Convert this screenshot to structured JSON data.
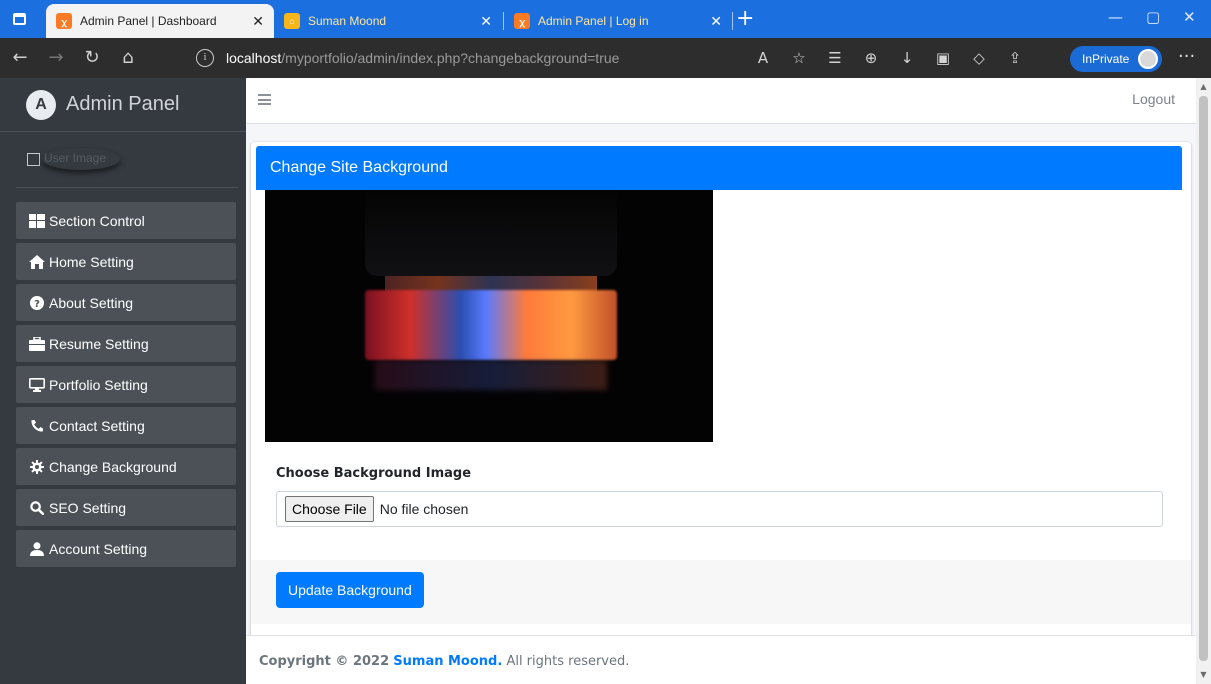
{
  "browser": {
    "tabs": [
      {
        "title": "Admin Panel | Dashboard",
        "favicon": "xampp-icon",
        "active": true
      },
      {
        "title": "Suman Moond",
        "favicon": "house-icon",
        "active": false
      },
      {
        "title": "Admin Panel | Log in",
        "favicon": "xampp-icon",
        "active": false
      }
    ],
    "url_host": "localhost",
    "url_path": "/myportfolio/admin/index.php?changebackground=true",
    "inprivate_label": "InPrivate",
    "accent_color": "#1c6fdf"
  },
  "sidebar": {
    "brand": "Admin Panel",
    "user_image_alt": "User Image",
    "items": [
      {
        "label": "Section Control",
        "icon": "grid-icon"
      },
      {
        "label": "Home Setting",
        "icon": "home-icon"
      },
      {
        "label": "About Setting",
        "icon": "question-circle-icon"
      },
      {
        "label": "Resume Setting",
        "icon": "briefcase-icon"
      },
      {
        "label": "Portfolio Setting",
        "icon": "desktop-icon"
      },
      {
        "label": "Contact Setting",
        "icon": "phone-icon"
      },
      {
        "label": "Change Background",
        "icon": "gear-icon"
      },
      {
        "label": "SEO Setting",
        "icon": "search-icon"
      },
      {
        "label": "Account Setting",
        "icon": "user-icon"
      }
    ]
  },
  "topnav": {
    "logout_label": "Logout"
  },
  "card": {
    "title": "Change Site Background",
    "field_label": "Choose Background Image",
    "choose_file_label": "Choose File",
    "no_file_text": "No file chosen",
    "submit_label": "Update Background",
    "primary_color": "#007bff"
  },
  "footer": {
    "copyright_prefix": "Copyright © 2022",
    "owner": "Suman Moond.",
    "suffix": "All rights reserved."
  }
}
